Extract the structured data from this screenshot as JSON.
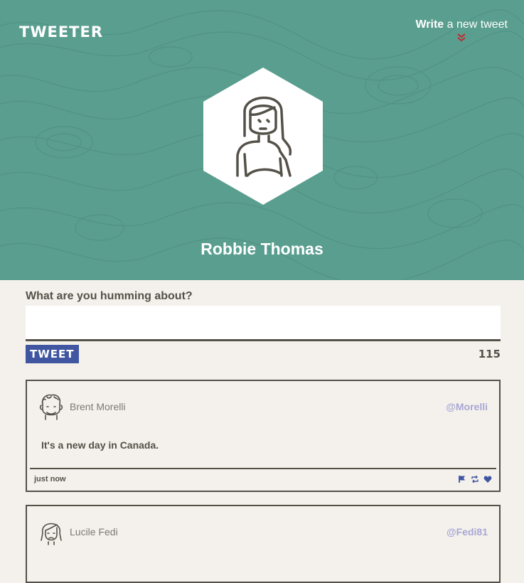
{
  "brand": "TWEETER",
  "compose_toggle": {
    "bold": "Write",
    "rest": " a new tweet"
  },
  "profile": {
    "name": "Robbie Thomas"
  },
  "composer": {
    "label": "What are you humming about?",
    "placeholder": "",
    "button_label": "TWEET",
    "counter": "115"
  },
  "tweets": [
    {
      "name": "Brent Morelli",
      "handle": "@Morelli",
      "text": "It's a new day in Canada.",
      "time": "just now"
    },
    {
      "name": "Lucile Fedi",
      "handle": "@Fedi81"
    }
  ],
  "colors": {
    "hero": "#5a9e8f",
    "accent": "#4056a1",
    "chevron": "#c0282d",
    "handle": "#a8a7d4",
    "text": "#545149",
    "page": "#f4f1ec"
  },
  "icons": [
    "chevron-double-down-icon",
    "flag-icon",
    "retweet-icon",
    "heart-icon"
  ]
}
